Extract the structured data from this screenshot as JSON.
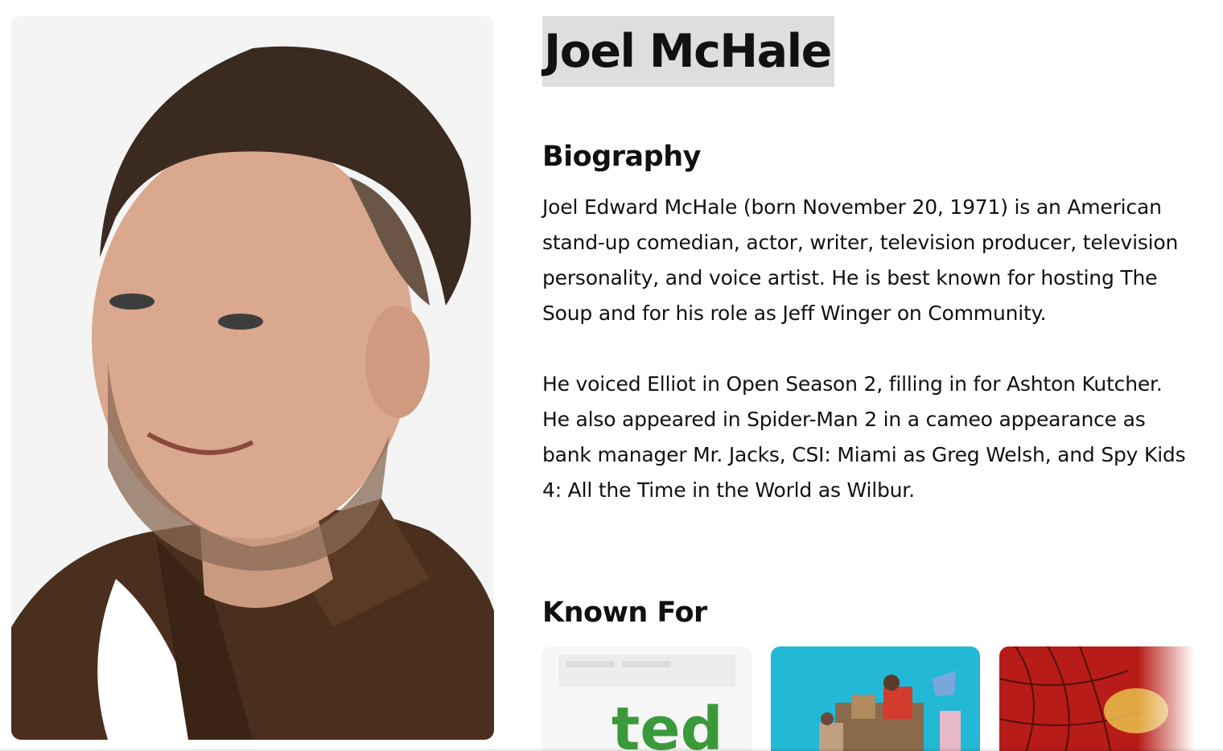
{
  "person": {
    "name": "Joel McHale",
    "photo_alt": "Joel McHale"
  },
  "biography": {
    "title": "Biography",
    "paragraphs": [
      "Joel Edward McHale (born November 20, 1971) is an American stand-up comedian, actor, writer, television producer, television personality, and voice artist. He is best known for hosting The Soup and for his role as Jeff Winger on Community.",
      "He voiced Elliot in Open Season 2, filling in for Ashton Kutcher. He also appeared in Spider-Man 2 in a cameo appearance as bank manager Mr. Jacks, CSI: Miami as Greg Welsh, and Spy Kids 4: All the Time in the World as Wilbur."
    ]
  },
  "known_for": {
    "title": "Known For",
    "items": [
      {
        "poster_text": "ted",
        "accent": "#3a9a3a"
      },
      {
        "poster_text": "",
        "accent": "#22b8d6"
      },
      {
        "poster_text": "",
        "accent": "#c8211c"
      }
    ]
  }
}
